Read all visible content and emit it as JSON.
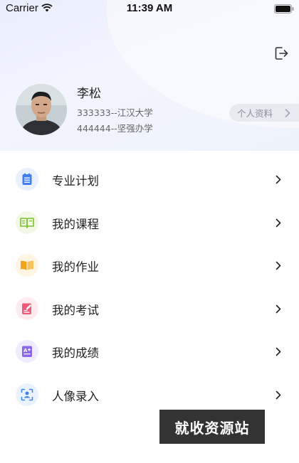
{
  "status_bar": {
    "carrier": "Carrier",
    "time": "11:39 AM"
  },
  "profile": {
    "name": "李松",
    "org_line_1": "333333--江汉大学",
    "org_line_2": "444444--坚强办学",
    "profile_button": "个人资料"
  },
  "menu": {
    "items": [
      {
        "label": "专业计划",
        "icon": "plan-list-icon",
        "color": "#3f7ff0"
      },
      {
        "label": "我的课程",
        "icon": "course-book-icon",
        "color": "#7cc22a"
      },
      {
        "label": "我的作业",
        "icon": "homework-book-icon",
        "color": "#f3a21b"
      },
      {
        "label": "我的考试",
        "icon": "exam-paper-icon",
        "color": "#ef5a7a"
      },
      {
        "label": "我的成绩",
        "icon": "grade-icon",
        "color": "#8a66e8"
      },
      {
        "label": "人像录入",
        "icon": "face-capture-icon",
        "color": "#3f86ee"
      }
    ]
  },
  "watermark": "就收资源站"
}
